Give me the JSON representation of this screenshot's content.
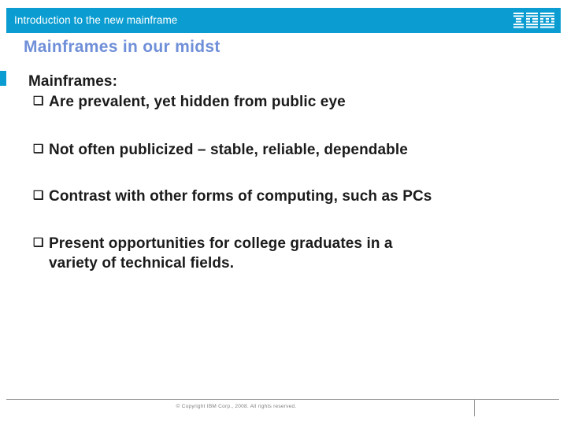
{
  "colors": {
    "banner_blue": "#0b9dd1",
    "title_blue": "#6f8fd8",
    "body_text": "#1b1b1b",
    "footer_gray": "#808080",
    "rule_gray": "#9a9a9a"
  },
  "banner": {
    "title": "Introduction to the new mainframe",
    "logo_alt": "IBM"
  },
  "slide": {
    "title": "Mainframes in our midst",
    "intro": "Mainframes:",
    "bullet_marker": "❑",
    "bullets": [
      {
        "lines": [
          "Are prevalent, yet hidden from public eye"
        ]
      },
      {
        "lines": [
          "Not often publicized – stable, reliable, dependable"
        ]
      },
      {
        "lines": [
          "Contrast with other forms of computing, such as PCs"
        ]
      },
      {
        "lines": [
          "Present opportunities for college graduates in a",
          "variety of technical fields."
        ]
      }
    ]
  },
  "footer": {
    "copyright": "© Copyright IBM Corp., 2008. All rights reserved."
  }
}
